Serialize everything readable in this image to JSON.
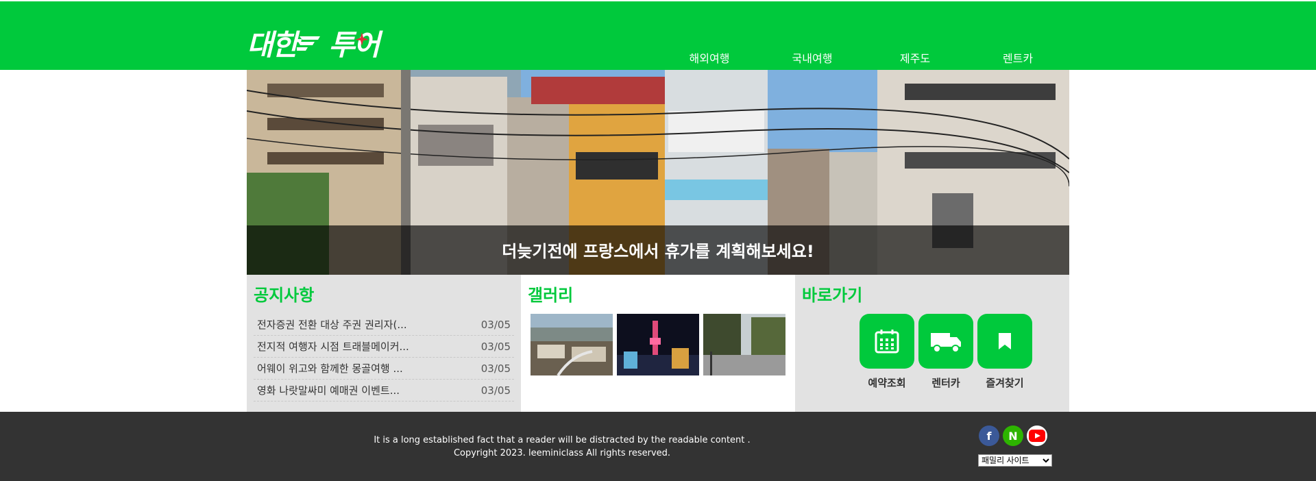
{
  "header": {
    "logo_text_left": "대한",
    "logo_text_right": "투어",
    "nav": [
      "해외여행",
      "국내여행",
      "제주도",
      "렌트카"
    ],
    "brand_color": "#00c93c"
  },
  "hero": {
    "caption": "더늦기전에 프랑스에서 휴가를 계획해보세요!"
  },
  "notice": {
    "title": "공지사항",
    "items": [
      {
        "text": "전자증권 전환 대상 주권 권리자(...",
        "date": "03/05"
      },
      {
        "text": "전지적 여행자 시점 트래블메이커...",
        "date": "03/05"
      },
      {
        "text": "어웨이 위고와 함께한 몽골여행 ...",
        "date": "03/05"
      },
      {
        "text": "영화 나랏말싸미 예매권 이벤트...",
        "date": "03/05"
      }
    ]
  },
  "gallery": {
    "title": "갤러리",
    "images": [
      "gallery-town-river",
      "gallery-night-tower",
      "gallery-street-trees"
    ]
  },
  "shortcut": {
    "title": "바로가기",
    "items": [
      {
        "icon": "calendar-icon",
        "label": "예약조회"
      },
      {
        "icon": "truck-icon",
        "label": "렌터카"
      },
      {
        "icon": "bookmark-icon",
        "label": "즐겨찾기"
      }
    ]
  },
  "footer": {
    "line1": "It is a long established fact that a reader will be distracted by the readable content .",
    "line2": "Copyright 2023. leeminiclass All rights reserved.",
    "socials": [
      {
        "icon": "facebook-icon",
        "glyph": "f",
        "color": "#3b5998"
      },
      {
        "icon": "naver-icon",
        "glyph": "N",
        "color": "#2db400"
      },
      {
        "icon": "youtube-icon",
        "glyph": "",
        "color": "#ff0000"
      }
    ],
    "family_site": "패밀리 사이트"
  }
}
